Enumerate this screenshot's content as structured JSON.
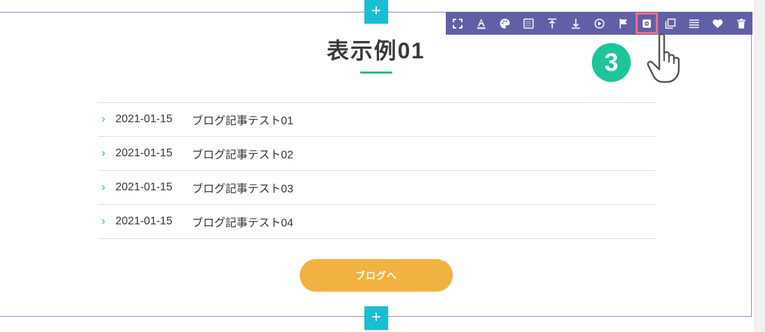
{
  "section": {
    "title": "表示例01",
    "add_label": "+",
    "list": [
      {
        "date": "2021-01-15",
        "title": "ブログ記事テスト01"
      },
      {
        "date": "2021-01-15",
        "title": "ブログ記事テスト02"
      },
      {
        "date": "2021-01-15",
        "title": "ブログ記事テスト03"
      },
      {
        "date": "2021-01-15",
        "title": "ブログ記事テスト04"
      }
    ],
    "chevron": "›",
    "button_label": "ブログへ"
  },
  "toolbar": {
    "icons": [
      "expand-icon",
      "text-color-icon",
      "palette-icon",
      "background-pattern-icon",
      "move-up-icon",
      "move-down-icon",
      "animation-icon",
      "flag-icon",
      "settings-icon",
      "duplicate-icon",
      "menu-icon",
      "favorite-icon",
      "delete-icon"
    ],
    "highlighted": "settings-icon"
  },
  "annotation": {
    "step_number": "3"
  },
  "colors": {
    "toolbar_bg": "#6160a6",
    "add_button": "#17bfd3",
    "accent_green": "#2bb791",
    "cta_orange": "#f2b242",
    "highlight_pink": "#ec6f8a",
    "badge_green": "#1cc59a"
  }
}
